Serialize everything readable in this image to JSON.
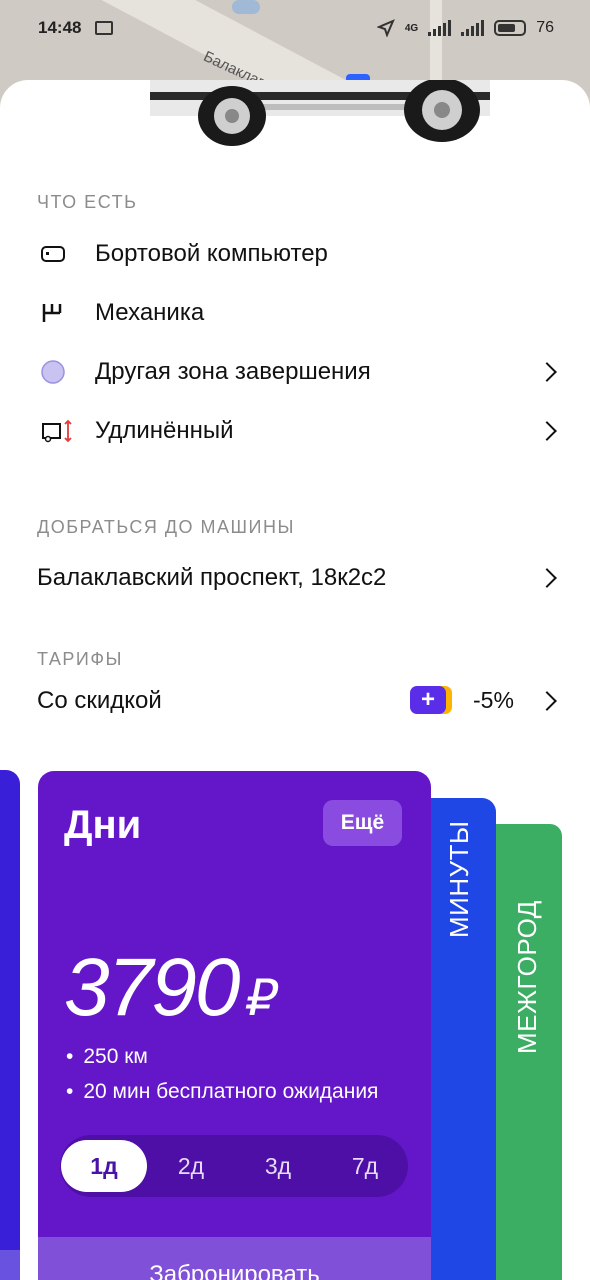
{
  "status_bar": {
    "time": "14:48",
    "network": "4G",
    "battery": "76"
  },
  "map": {
    "street_label": "Балаклав"
  },
  "features": {
    "label": "ЧТО ЕСТЬ",
    "items": [
      {
        "label": "Бортовой компьютер",
        "icon": "onboard-computer-icon"
      },
      {
        "label": "Механика",
        "icon": "manual-gearbox-icon"
      },
      {
        "label": "Другая зона завершения",
        "icon": "zone-circle-icon",
        "color": "#c9c3f2"
      },
      {
        "label": "Удлинённый",
        "icon": "long-van-icon"
      }
    ]
  },
  "get_to_car": {
    "label": "ДОБРАТЬСЯ ДО МАШИНЫ",
    "address": "Балаклавский проспект, 18к2с2"
  },
  "tariffs": {
    "label": "ТАРИФЫ",
    "discount_label": "Со скидкой",
    "plus_symbol": "+",
    "discount_value": "-5%"
  },
  "cards": {
    "main": {
      "title": "Дни",
      "more_label": "Ещё",
      "price": "3790",
      "currency": "₽",
      "features": [
        "250 км",
        "20 мин бесплатного ожидания"
      ],
      "durations": [
        "1д",
        "2д",
        "3д",
        "7д"
      ],
      "selected_duration": "1д",
      "book_label": "Забронировать",
      "color": "#6416c9"
    },
    "minutes": {
      "label": "МИНУТЫ",
      "color": "#1f47e6"
    },
    "intercity": {
      "label": "МЕЖГОРОД",
      "color": "#3cae64"
    }
  }
}
